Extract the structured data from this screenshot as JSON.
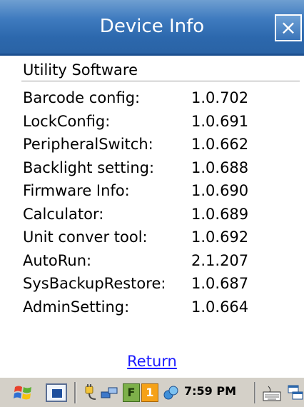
{
  "window": {
    "title": "Device Info",
    "close_label": "×"
  },
  "section_title": "Utility Software",
  "items": [
    {
      "name": "Barcode config:",
      "version": "1.0.702"
    },
    {
      "name": "LockConfig:",
      "version": "1.0.691"
    },
    {
      "name": "PeripheralSwitch:",
      "version": "1.0.662"
    },
    {
      "name": "Backlight setting:",
      "version": "1.0.688"
    },
    {
      "name": "Firmware Info:",
      "version": "1.0.690"
    },
    {
      "name": "Calculator:",
      "version": "1.0.689"
    },
    {
      "name": "Unit conver tool:",
      "version": "1.0.692"
    },
    {
      "name": "AutoRun:",
      "version": "2.1.207"
    },
    {
      "name": "SysBackupRestore:",
      "version": "1.0.687"
    },
    {
      "name": "AdminSetting:",
      "version": "1.0.664"
    }
  ],
  "return_label": "Return",
  "taskbar": {
    "f_label": "F",
    "one_label": "1",
    "time": "7:59 PM",
    "icons": [
      "windows-start-icon",
      "desktop-icon",
      "power-plug-icon",
      "network-icon",
      "f-key-icon",
      "one-key-icon",
      "sync-icon",
      "keyboard-icon",
      "window-switch-icon"
    ]
  },
  "colors": {
    "titlebar": "#2c68ad",
    "link": "#1a1aff",
    "taskbar": "#d4d0c8"
  }
}
